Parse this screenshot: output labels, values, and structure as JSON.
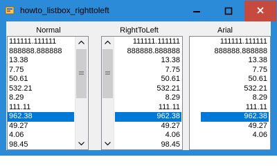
{
  "window": {
    "title": "howto_listbox_righttoleft"
  },
  "columns": [
    {
      "label": "Normal"
    },
    {
      "label": "RightToLeft"
    },
    {
      "label": "Arial"
    }
  ],
  "lists": {
    "normal": [
      "111111.111111",
      "888888.888888",
      "13.38",
      "7.75",
      "50.61",
      "532.21",
      "8.29",
      "111.11",
      "962.38",
      "49.27",
      "4.06",
      "98.45"
    ],
    "righttoleft": [
      "111111.111111",
      "888888.888888",
      "13.38",
      "7.75",
      "50.61",
      "532.21",
      "8.29",
      "111.11",
      "962.38",
      "49.27",
      "4.06",
      "98.45"
    ],
    "arial": [
      "111111.111111",
      "888888.888888",
      "13.38",
      "7.75",
      "50.61",
      "532.21",
      "8.29",
      "111.11",
      "962.38",
      "49.27",
      "4.06"
    ]
  },
  "selected_index": 8,
  "colors": {
    "title_bar": "#2b8bd8",
    "close": "#c74a3f",
    "selection": "#0078d7",
    "client": "#f0f0f0"
  }
}
